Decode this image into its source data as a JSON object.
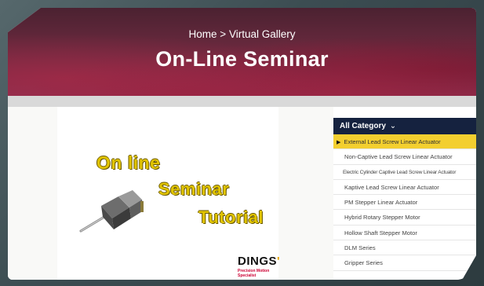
{
  "breadcrumb": {
    "home": "Home",
    "separator": ">",
    "current": "Virtual Gallery"
  },
  "page_title": "On-Line Seminar",
  "video": {
    "line1": "On line",
    "line2": "Seminar",
    "line3": "Tutorial",
    "brand": "DINGS",
    "brand_mark": "'",
    "brand_tagline": "Precision Motion Specialist"
  },
  "category": {
    "header": "All Category",
    "header_icon": "chevron-down-icon",
    "items": [
      {
        "label": "External Lead Screw Linear Actuator",
        "active": true
      },
      {
        "label": "Non-Captive Lead Screw Linear Actuator"
      },
      {
        "label": "Electric Cylinder Captive Lead Screw Linear Actuator"
      },
      {
        "label": "Kaptive Lead Screw Linear Actuator"
      },
      {
        "label": "PM Stepper Linear Actuator"
      },
      {
        "label": "Hybrid Rotary Stepper Motor"
      },
      {
        "label": "Hollow Shaft Stepper Motor"
      },
      {
        "label": "DLM Series"
      },
      {
        "label": "Gripper Series"
      }
    ]
  },
  "colors": {
    "hero": "#6e2a40",
    "sidebar_header": "#15223f",
    "active_item": "#f3cf2f",
    "title_text": "#e1c400"
  }
}
